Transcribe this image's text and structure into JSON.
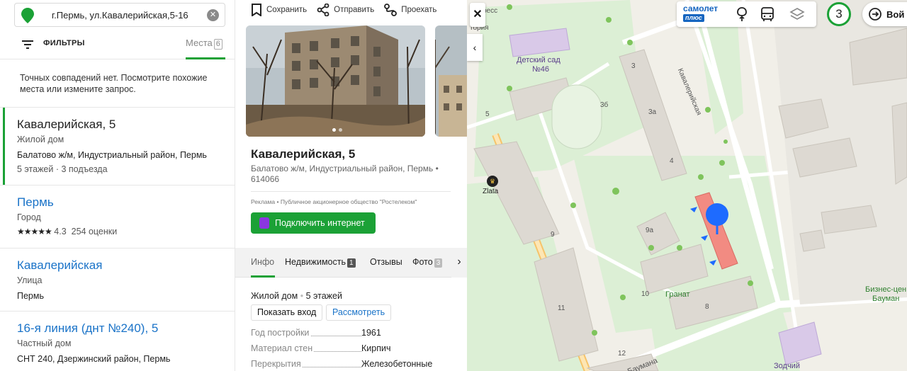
{
  "search": {
    "query": "г.Пермь, ул.Кавалерийская,5-16",
    "clear_icon": "close-icon"
  },
  "filters": {
    "label": "ФИЛЬТРЫ",
    "places_label": "Места",
    "places_count": "6"
  },
  "no_match": "Точных совпадений нет. Посмотрите похожие места или измените запрос.",
  "results": [
    {
      "title": "Кавалерийская, 5",
      "subtitle": "Жилой дом",
      "address": "Балатово ж/м, Индустриальный район, Пермь",
      "meta": "5 этажей · 3 подъезда"
    },
    {
      "title": "Пермь",
      "subtitle": "Город",
      "rating": "4.3",
      "reviews": "254 оценки"
    },
    {
      "title": "Кавалерийская",
      "subtitle": "Улица",
      "address": "Пермь"
    },
    {
      "title": "16-я линия (днт №240), 5",
      "subtitle": "Частный дом",
      "address": "СНТ 240, Дзержинский район, Пермь"
    }
  ],
  "card": {
    "actions": {
      "save": "Сохранить",
      "share": "Отправить",
      "route": "Проехать"
    },
    "title": "Кавалерийская, 5",
    "address": "Балатово ж/м, Индустриальный район, Пермь",
    "postcode": "614066",
    "ad_label": "Реклама",
    "ad_company": "Публичное акционерное общество \"Ростелеком\"",
    "ad_button": "Подключить интернет",
    "tabs": [
      {
        "label": "Инфо"
      },
      {
        "label": "Недвижимость",
        "count": "1"
      },
      {
        "label": "Отзывы"
      },
      {
        "label": "Фото",
        "count": "3"
      }
    ],
    "building_type": "Жилой дом",
    "building_floors": "5 этажей",
    "btn_entrance": "Показать вход",
    "btn_view": "Рассмотреть",
    "specs": [
      {
        "key": "Год постройки",
        "value": "1961"
      },
      {
        "key": "Материал стен",
        "value": "Кирпич"
      },
      {
        "key": "Перекрытия",
        "value": "Железобетонные"
      }
    ]
  },
  "map": {
    "brand_top": "самолет",
    "brand_bottom": "плюс",
    "traffic_score": "3",
    "login_label": "Вой",
    "labels": {
      "kindergarten": "Детский сад",
      "kindergarten_num": "№46",
      "street_kav": "Кавалерийская",
      "street_baumana": "Баумана",
      "zlata": "Zlata",
      "granat": "Гранат",
      "business": "Бизнес-цен",
      "business2": "Бауман",
      "zodchiy": "Зодчий",
      "top_left1": "ресс",
      "top_left2": "тория",
      "n3": "3",
      "n3b": "3б",
      "n3a": "3а",
      "n4": "4",
      "n5": "5",
      "n9": "9",
      "n9a": "9а",
      "n10": "10",
      "n11": "11",
      "n8": "8",
      "n12": "12"
    }
  },
  "colors": {
    "accent": "#1ba136",
    "link": "#1a73c8",
    "building": "#f28b82",
    "marker": "#1e6bff"
  }
}
